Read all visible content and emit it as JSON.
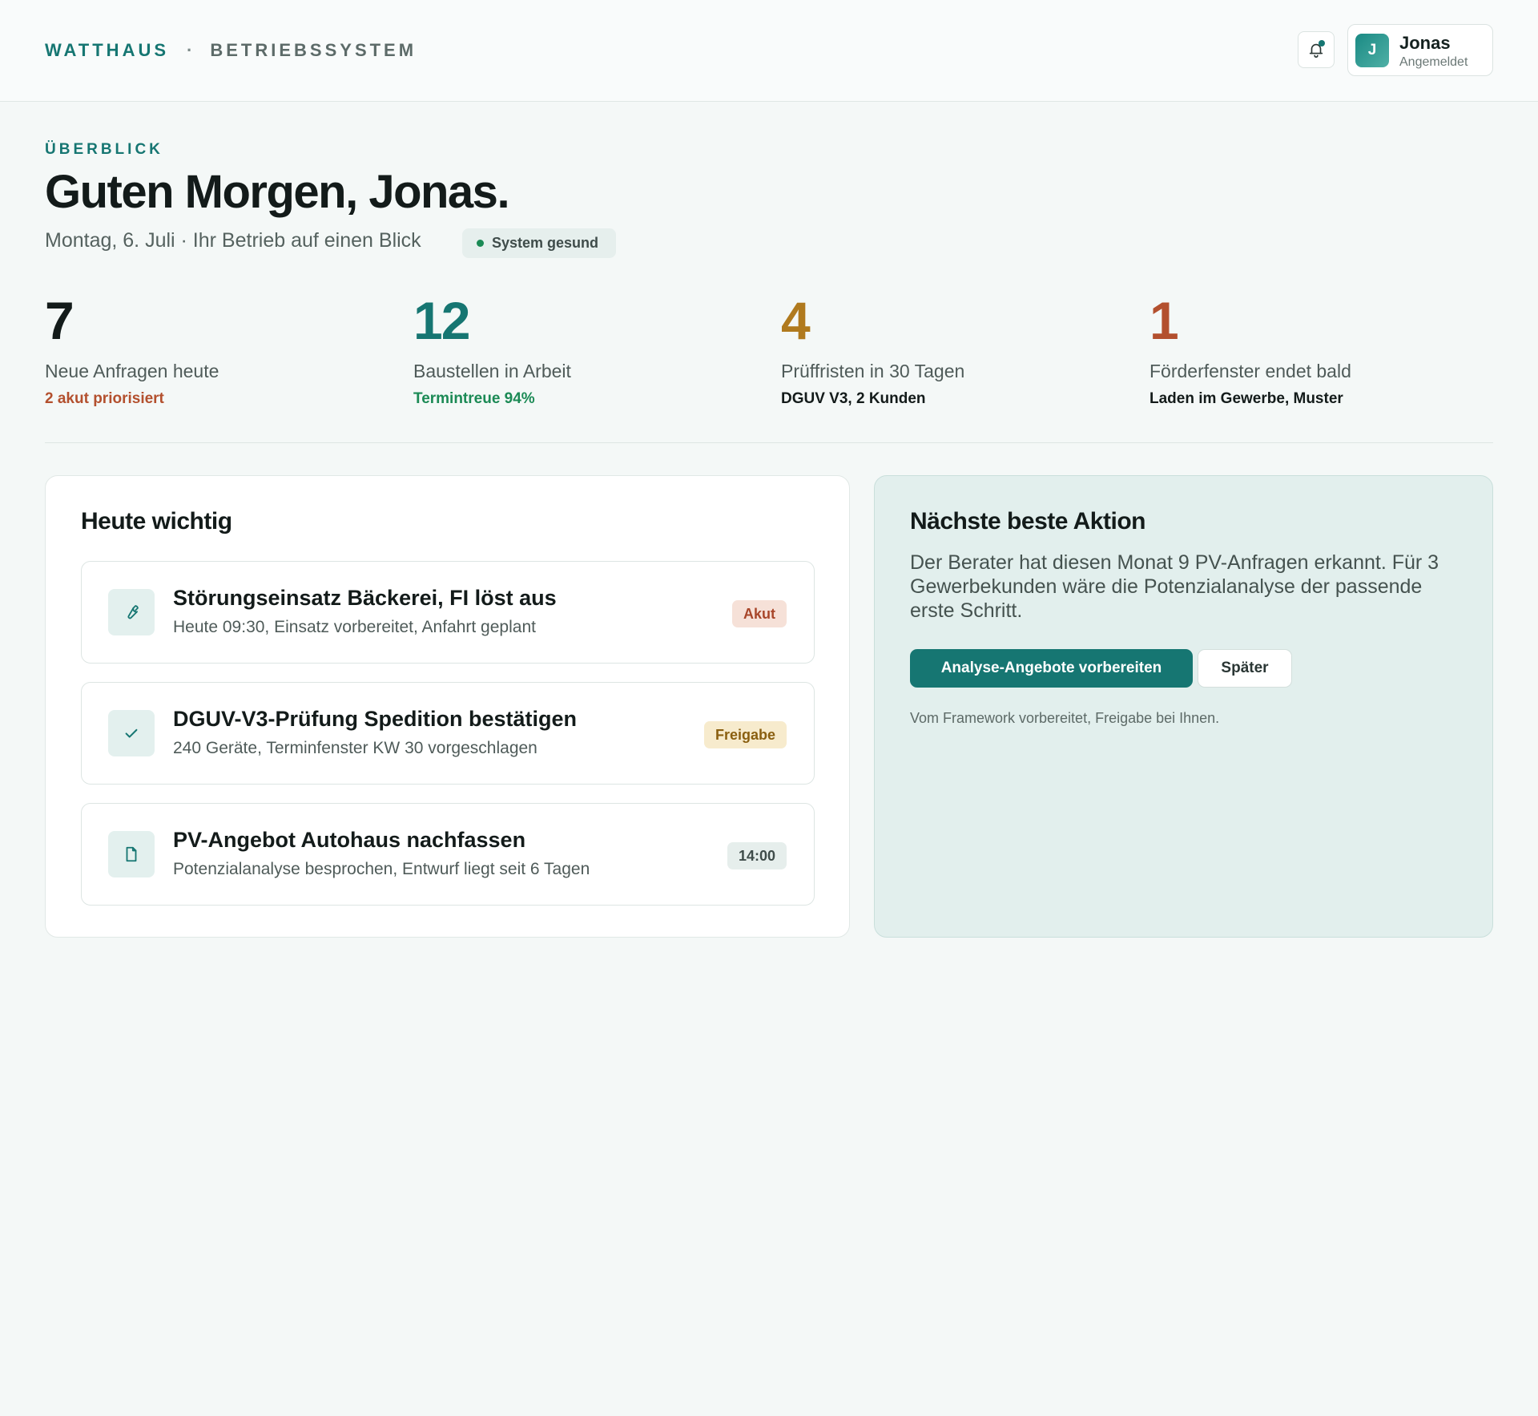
{
  "header": {
    "brand": "WATTHAUS",
    "separator": "·",
    "product": "BETRIEBSSYSTEM",
    "user": {
      "initial": "J",
      "name": "Jonas",
      "status": "Angemeldet"
    }
  },
  "hero": {
    "eyebrow": "ÜBERBLICK",
    "title": "Guten Morgen, Jonas.",
    "subtitle": "Montag, 6. Juli · Ihr Betrieb auf einen Blick",
    "health_badge": "System gesund"
  },
  "stats": [
    {
      "value": "7",
      "label": "Neue Anfragen heute",
      "note": "2 akut priorisiert",
      "value_color": "#131b1a",
      "note_color": "#b3502e"
    },
    {
      "value": "12",
      "label": "Baustellen in Arbeit",
      "note": "Termintreue 94%",
      "value_color": "#167672",
      "note_color": "#1b8a55"
    },
    {
      "value": "4",
      "label": "Prüffristen in 30 Tagen",
      "note": "DGUV V3, 2 Kunden",
      "value_color": "#b07a1e",
      "note_color": "#131b1a"
    },
    {
      "value": "1",
      "label": "Förderfenster endet bald",
      "note": "Laden im Gewerbe, Muster",
      "value_color": "#b3502e",
      "note_color": "#131b1a"
    }
  ],
  "today": {
    "title": "Heute wichtig",
    "tasks": [
      {
        "icon": "wrench-icon",
        "title": "Störungseinsatz Bäckerei, FI löst aus",
        "meta": "Heute 09:30, Einsatz vorbereitet, Anfahrt geplant",
        "badge": "Akut",
        "badge_bg": "#f6e1d8",
        "badge_color": "#a8462a"
      },
      {
        "icon": "check-icon",
        "title": "DGUV-V3-Prüfung Spedition bestätigen",
        "meta": "240 Geräte, Terminfenster KW 30 vorgeschlagen",
        "badge": "Freigabe",
        "badge_bg": "#f7ebcd",
        "badge_color": "#8a5f10"
      },
      {
        "icon": "document-icon",
        "title": "PV-Angebot Autohaus nachfassen",
        "meta": "Potenzialanalyse besprochen, Entwurf liegt seit 6 Tagen",
        "badge": "14:00",
        "badge_bg": "#e6eeec",
        "badge_color": "#3f4c4a"
      }
    ]
  },
  "next_action": {
    "title": "Nächste beste Aktion",
    "text": "Der Berater hat diesen Monat 9 PV-Anfragen erkannt. Für 3 Gewerbekunden wäre die Potenzialanalyse der passende erste Schritt.",
    "primary_label": "Analyse-Angebote vorbereiten",
    "secondary_label": "Später",
    "footnote": "Vom Framework vorbereitet, Freigabe bei Ihnen."
  },
  "colors": {
    "accent": "#167672",
    "background": "#f4f8f7",
    "success": "#1b8a55"
  }
}
